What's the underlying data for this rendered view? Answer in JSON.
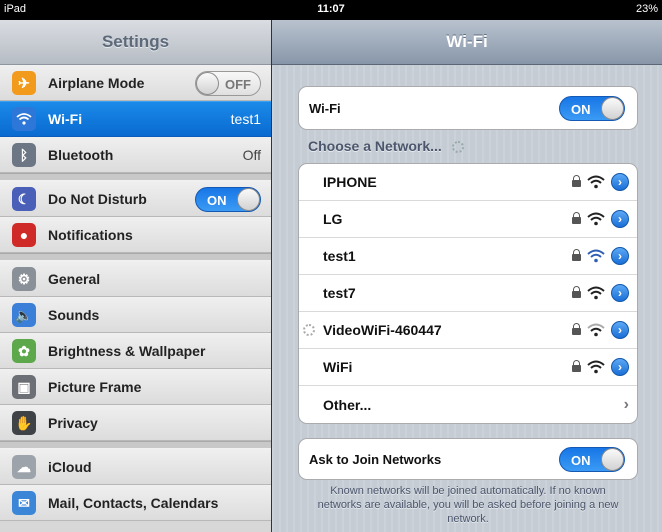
{
  "status_bar": {
    "carrier": "iPad",
    "time": "11:07",
    "battery": "23%"
  },
  "left": {
    "title": "Settings",
    "items": [
      {
        "label": "Airplane Mode",
        "toggle": "OFF",
        "icon": "airplane-icon",
        "color": "#f29a1c"
      },
      {
        "label": "Wi-Fi",
        "value": "test1",
        "icon": "wifi-icon",
        "color": "#2c77d8",
        "selected": true
      },
      {
        "label": "Bluetooth",
        "value": "Off",
        "icon": "bluetooth-icon",
        "color": "#6c7684"
      },
      {
        "label": "Do Not Disturb",
        "toggle": "ON",
        "icon": "moon-icon",
        "color": "#4a5fb8"
      },
      {
        "label": "Notifications",
        "icon": "notifications-icon",
        "color": "#cf2a27"
      },
      {
        "label": "General",
        "icon": "gear-icon",
        "color": "#8a9097"
      },
      {
        "label": "Sounds",
        "icon": "speaker-icon",
        "color": "#3c7fd8"
      },
      {
        "label": "Brightness & Wallpaper",
        "icon": "flower-icon",
        "color": "#5ca84a"
      },
      {
        "label": "Picture Frame",
        "icon": "picture-frame-icon",
        "color": "#6c7076"
      },
      {
        "label": "Privacy",
        "icon": "hand-icon",
        "color": "#3f4246"
      },
      {
        "label": "iCloud",
        "icon": "cloud-icon",
        "color": "#9ca3ab"
      },
      {
        "label": "Mail, Contacts, Calendars",
        "icon": "mail-icon",
        "color": "#3c86d8"
      }
    ]
  },
  "right": {
    "title": "Wi-Fi",
    "wifi": {
      "label": "Wi-Fi",
      "toggle": "ON"
    },
    "section_header": "Choose a Network...",
    "networks": [
      {
        "name": "IPHONE",
        "active": false
      },
      {
        "name": "LG",
        "active": false
      },
      {
        "name": "test1",
        "active": true
      },
      {
        "name": "test7",
        "active": false
      },
      {
        "name": "VideoWiFi-460447",
        "active": false,
        "connecting": true
      },
      {
        "name": "WiFi",
        "active": false
      }
    ],
    "other": "Other...",
    "ask_to_join": {
      "label": "Ask to Join Networks",
      "toggle": "ON"
    },
    "note": "Known networks will be joined automatically. If no known networks are available, you will be asked before joining a new network."
  },
  "colors": {
    "selected": "#0a6ad0",
    "toggle_on": "#1876e6",
    "disclosure": "#1b6fd6"
  }
}
